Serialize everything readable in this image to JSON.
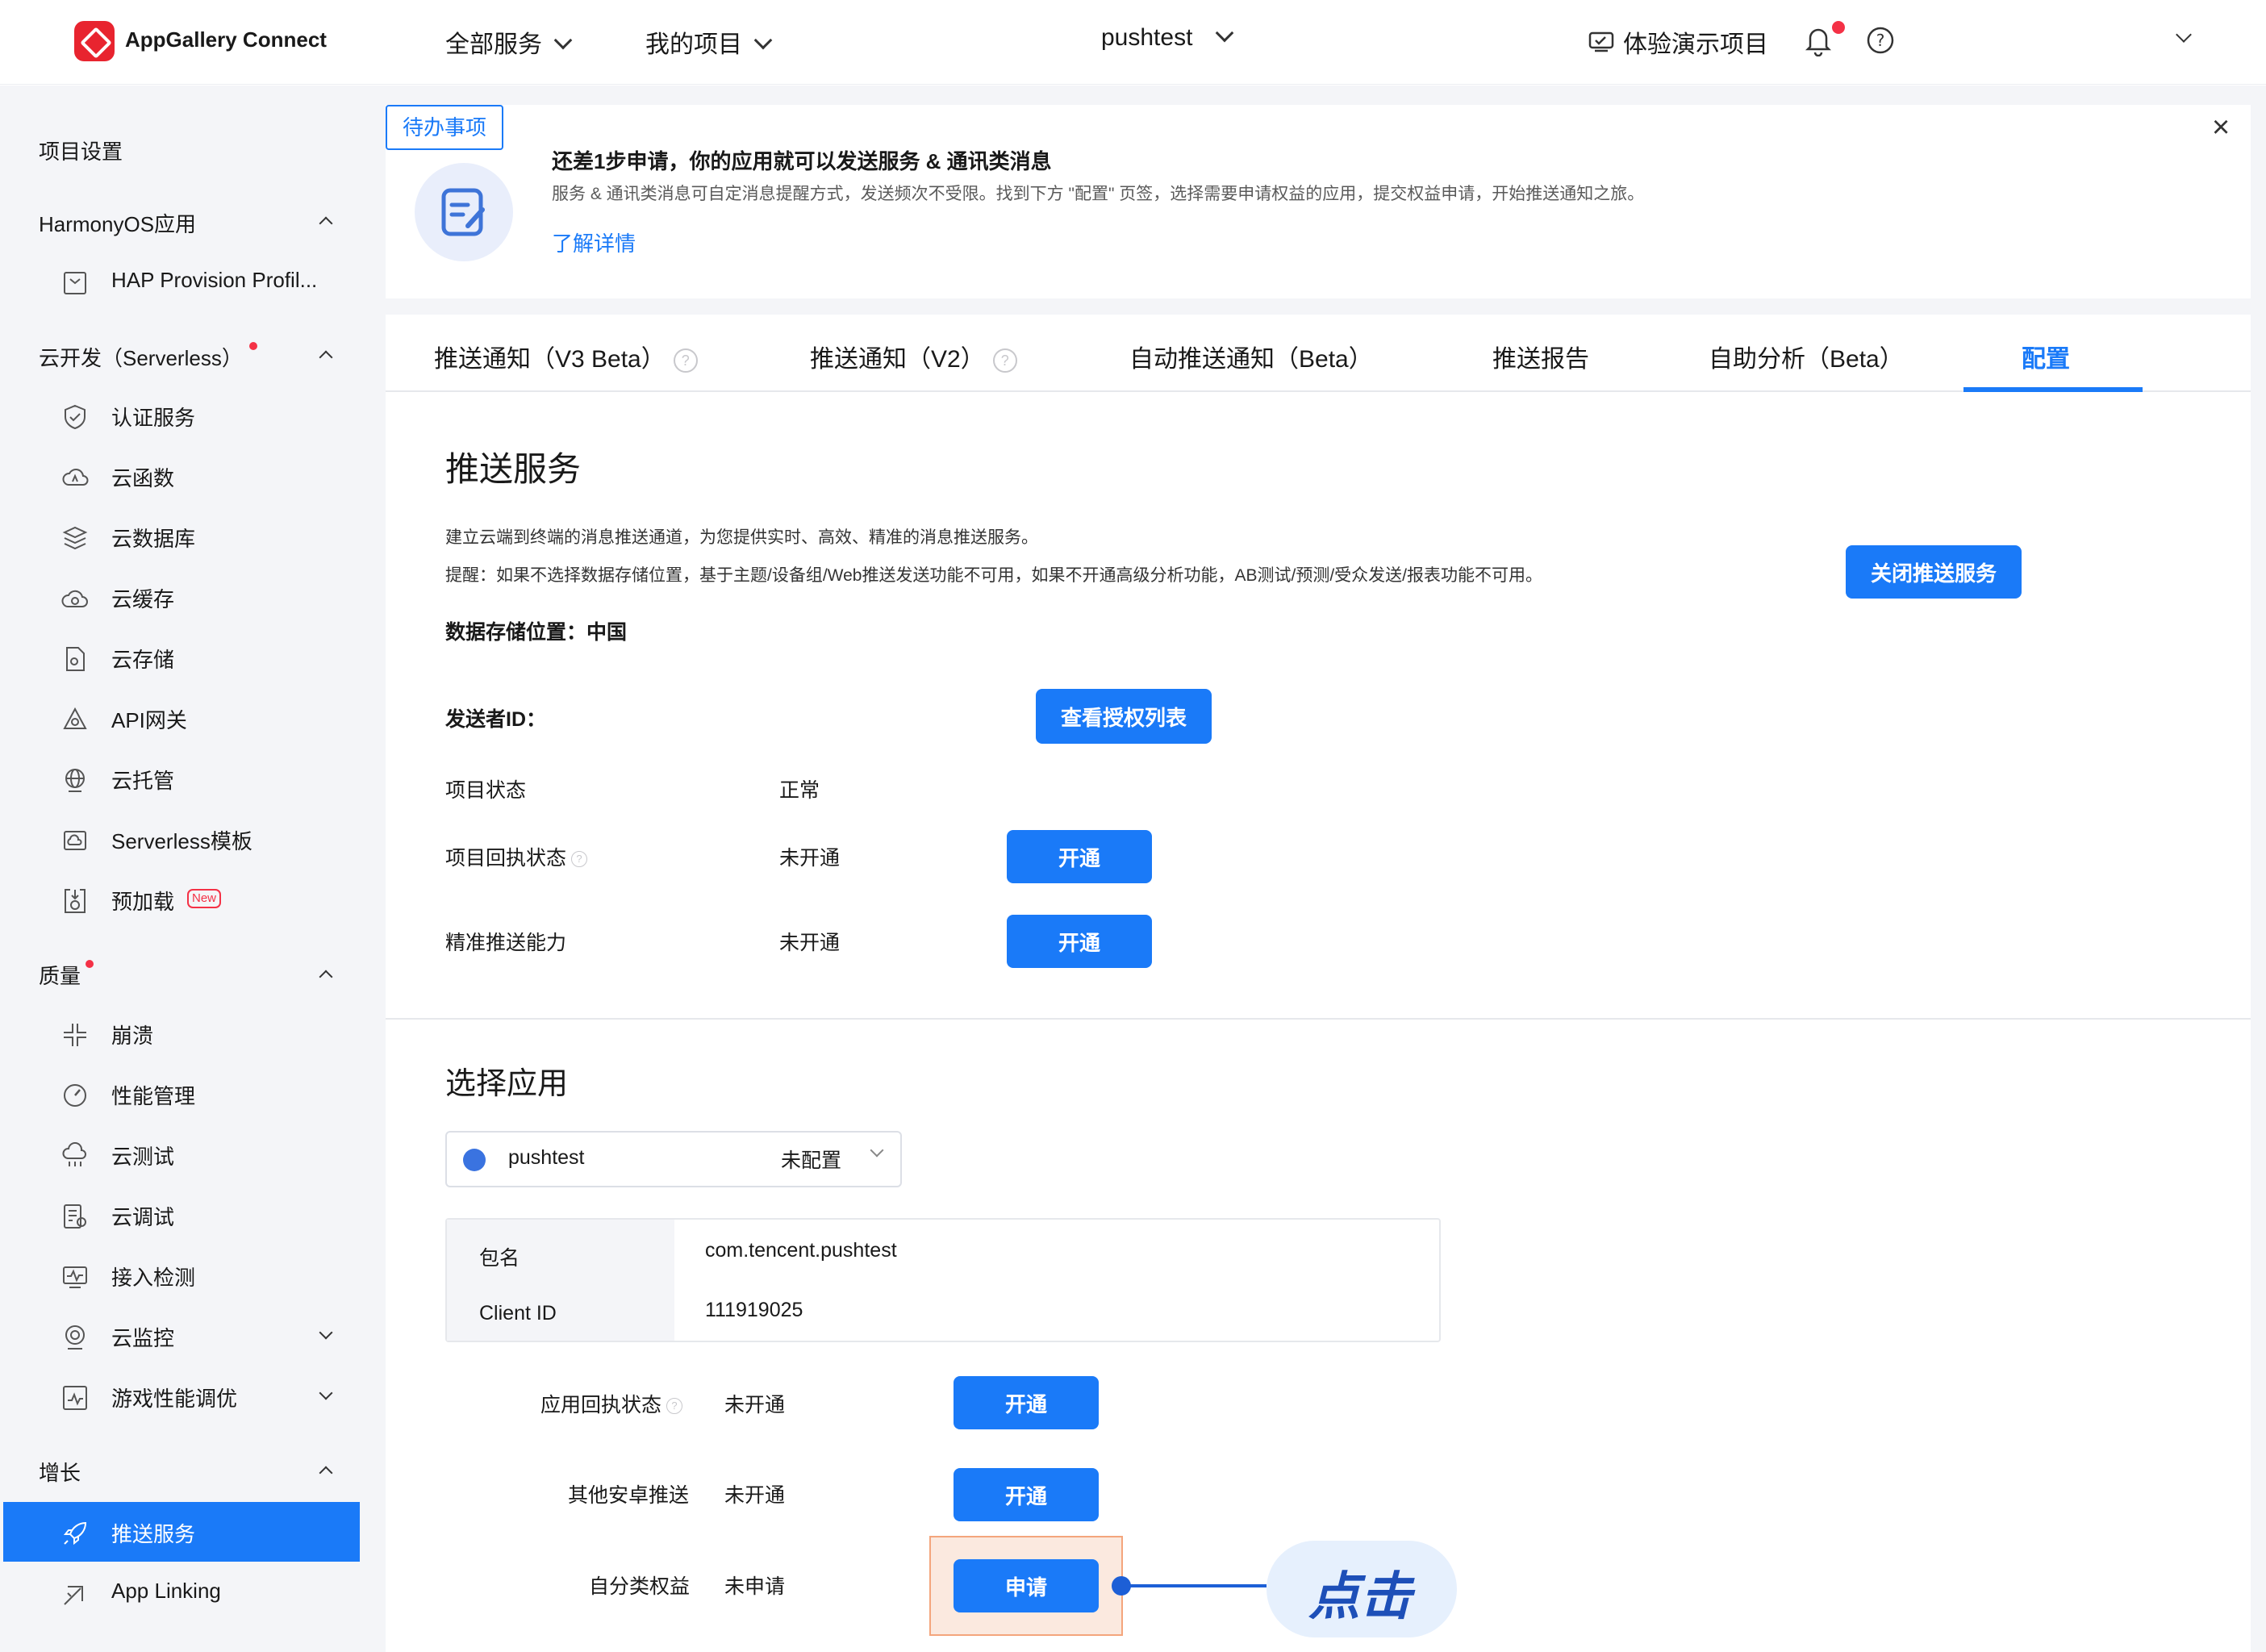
{
  "header": {
    "brand": "AppGallery Connect",
    "nav": [
      "全部服务",
      "我的项目"
    ],
    "project": "pushtest",
    "demo": "体验演示项目"
  },
  "sidebar": {
    "project_settings": "项目设置",
    "groups": {
      "harmony": "HarmonyOS应用",
      "serverless": "云开发（Serverless）",
      "quality": "质量",
      "growth": "增长"
    },
    "items": {
      "hap": "HAP Provision Profil...",
      "auth": "认证服务",
      "func": "云函数",
      "db": "云数据库",
      "cache": "云缓存",
      "storage": "云存储",
      "api": "API网关",
      "hosting": "云托管",
      "template": "Serverless模板",
      "preload": "预加载",
      "crash": "崩溃",
      "perf": "性能管理",
      "test": "云测试",
      "debug": "云调试",
      "access": "接入检测",
      "monitor": "云监控",
      "game": "游戏性能调优",
      "push": "推送服务",
      "linking": "App Linking"
    },
    "new_badge": "New"
  },
  "banner": {
    "tag": "待办事项",
    "title": "还差1步申请，你的应用就可以发送服务 & 通讯类消息",
    "desc": "服务 & 通讯类消息可自定消息提醒方式，发送频次不受限。找到下方 \"配置\" 页签，选择需要申请权益的应用，提交权益申请，开始推送通知之旅。",
    "link": "了解详情",
    "close": "×"
  },
  "tabs": [
    "推送通知（V3 Beta）",
    "推送通知（V2）",
    "自动推送通知（Beta）",
    "推送报告",
    "自助分析（Beta）",
    "配置"
  ],
  "push_service": {
    "title": "推送服务",
    "desc1": "建立云端到终端的消息推送通道，为您提供实时、高效、精准的消息推送服务。",
    "desc2": "提醒：如果不选择数据存储位置，基于主题/设备组/Web推送发送功能不可用，如果不开通高级分析功能，AB测试/预测/受众发送/报表功能不可用。",
    "close_btn": "关闭推送服务",
    "storage_label": "数据存储位置：",
    "storage_value": "中国",
    "sender_label": "发送者ID：",
    "auth_list_btn": "查看授权列表",
    "status_label": "项目状态",
    "status_value": "正常",
    "receipt_label": "项目回执状态",
    "receipt_value": "未开通",
    "precise_label": "精准推送能力",
    "precise_value": "未开通",
    "open_btn": "开通"
  },
  "select_app": {
    "title": "选择应用",
    "app_name": "pushtest",
    "app_status": "未配置",
    "package_label": "包名",
    "package_value": "com.tencent.pushtest",
    "client_label": "Client ID",
    "client_value": "111919025",
    "app_receipt_label": "应用回执状态",
    "app_receipt_value": "未开通",
    "other_push_label": "其他安卓推送",
    "other_push_value": "未开通",
    "self_class_label": "自分类权益",
    "self_class_value": "未申请",
    "open_btn": "开通",
    "apply_btn": "申请"
  },
  "annotation": {
    "text": "点击"
  },
  "colors": {
    "primary": "#1a7af8",
    "sidebar_bg": "#f4f5f8",
    "alert_red": "#f43146",
    "highlight": "#f4a57c"
  }
}
